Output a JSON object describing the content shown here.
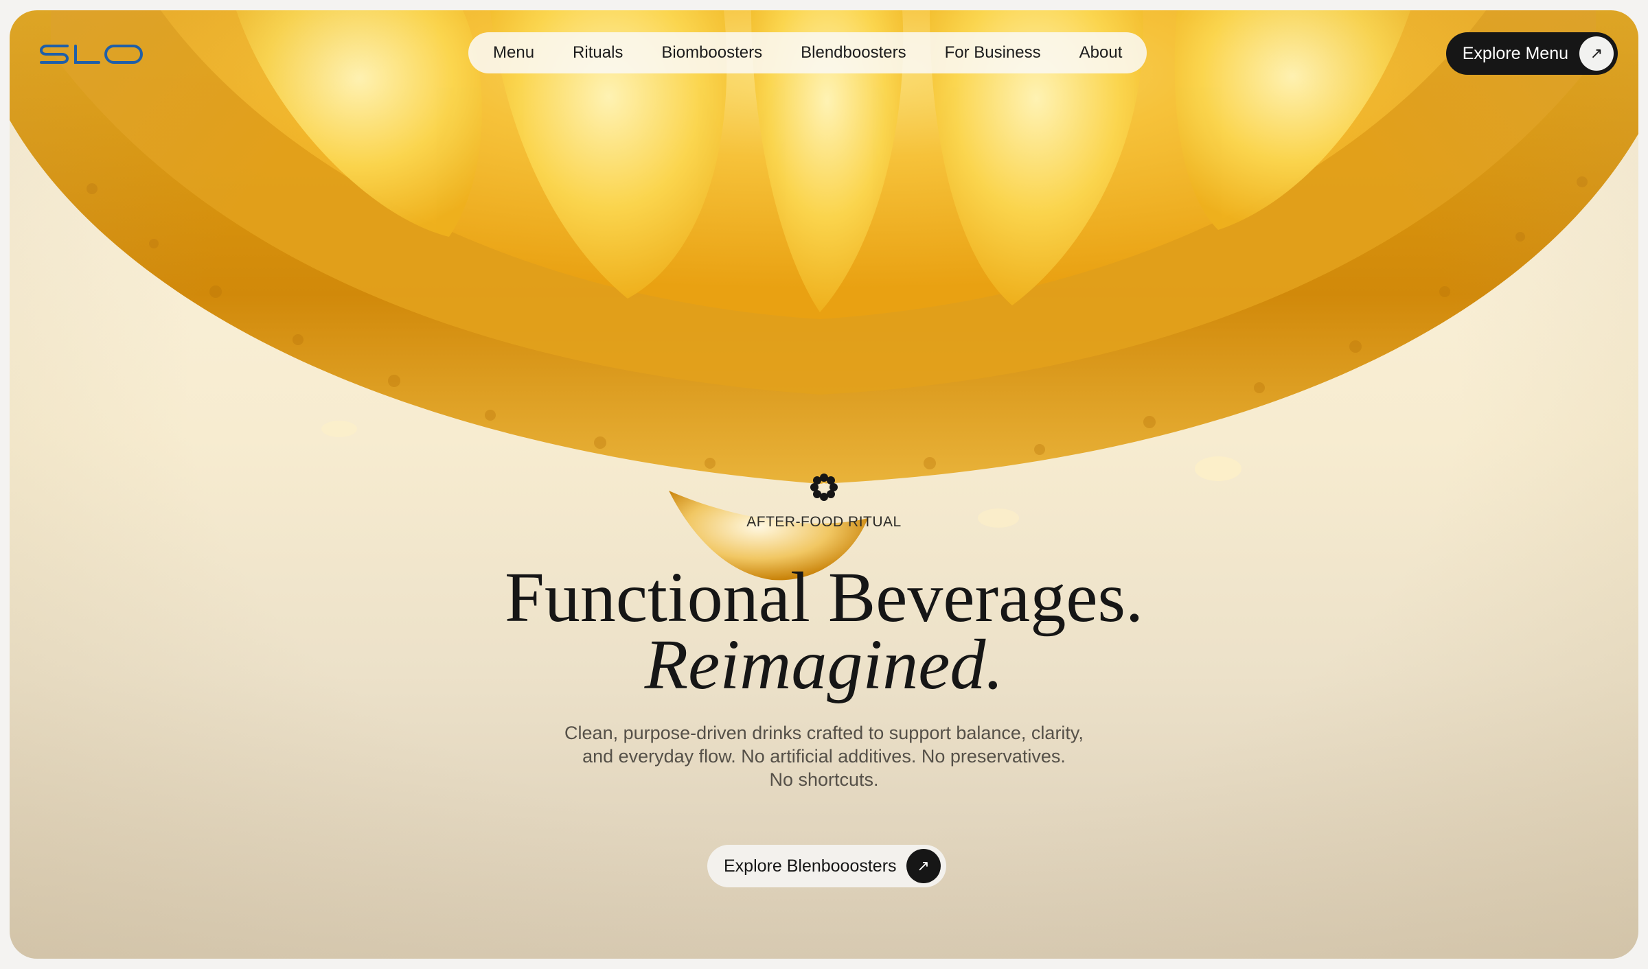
{
  "brand": {
    "logo_text": "SLO",
    "logo_color": "#1f5fa8"
  },
  "nav": {
    "items": [
      {
        "label": "Menu"
      },
      {
        "label": "Rituals"
      },
      {
        "label": "Biomboosters"
      },
      {
        "label": "Blendboosters"
      },
      {
        "label": "For Business"
      },
      {
        "label": "About"
      }
    ]
  },
  "header_cta": {
    "label": "Explore Menu",
    "icon": "arrow-up-right-icon",
    "arrow_glyph": "↗"
  },
  "hero": {
    "badge_icon": "flower-icon",
    "eyebrow": "AFTER-FOOD RITUAL",
    "headline_line1": "Functional Beverages.",
    "headline_line2": "Reimagined.",
    "subtext_line1": "Clean, purpose-driven drinks crafted to support balance, clarity,",
    "subtext_line2": "and everyday flow. No artificial additives. No preservatives.",
    "subtext_line3": "No shortcuts.",
    "cta_label": "Explore Blenbooosters",
    "cta_icon": "arrow-up-right-icon",
    "cta_arrow_glyph": "↗"
  },
  "colors": {
    "dark": "#161616",
    "citrus": "#e9a71a",
    "background": "#f7ecd0"
  }
}
